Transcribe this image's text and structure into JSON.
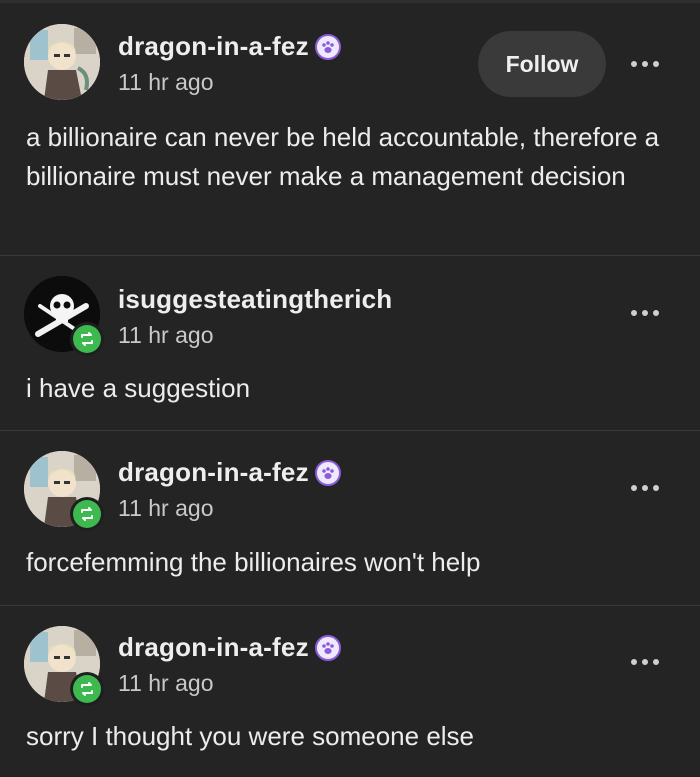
{
  "posts": [
    {
      "username": "dragon-in-a-fez",
      "timestamp": "11 hr ago",
      "text": "a billionaire can never be held accountable, therefore a billionaire must never make a management decision",
      "follow_label": "Follow",
      "avatar": "anime-character-avatar",
      "badge": "paw-badge-icon"
    },
    {
      "username": "isuggesteatingtherich",
      "timestamp": "11 hr ago",
      "text": "i have a suggestion",
      "avatar": "skull-crossbones-avatar",
      "badge": "reblog-icon"
    },
    {
      "username": "dragon-in-a-fez",
      "timestamp": "11 hr ago",
      "text": "forcefemming the billionaires won't help",
      "avatar": "anime-character-avatar",
      "badge": "paw-badge-icon"
    },
    {
      "username": "dragon-in-a-fez",
      "timestamp": "11 hr ago",
      "text": "sorry I thought you were someone else",
      "avatar": "anime-character-avatar",
      "badge": "paw-badge-icon"
    }
  ],
  "colors": {
    "background": "#242424",
    "reblog_green": "#3db94f",
    "badge_purple": "#8c5cd6"
  }
}
